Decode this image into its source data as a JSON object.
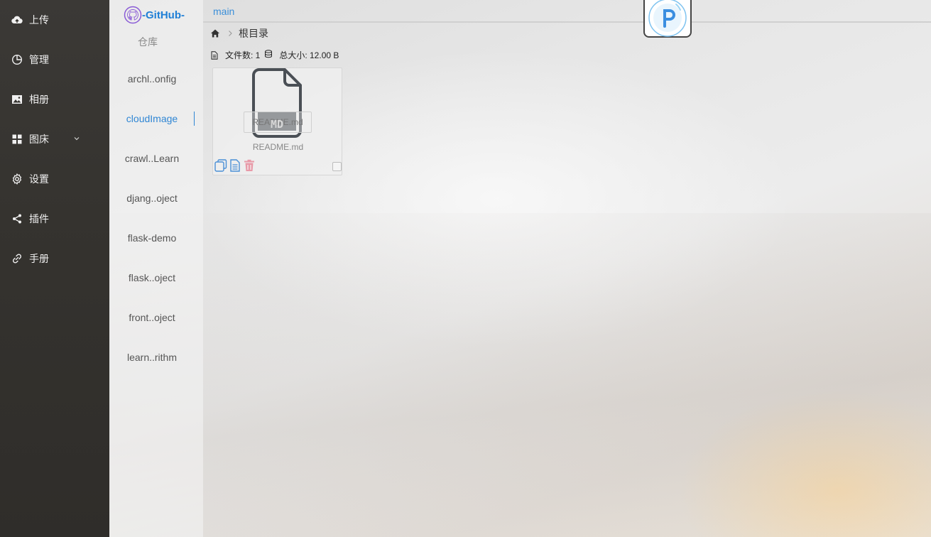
{
  "nav": {
    "items": [
      {
        "label": "上传",
        "icon": "cloud-upload-icon"
      },
      {
        "label": "管理",
        "icon": "pie-chart-icon"
      },
      {
        "label": "相册",
        "icon": "picture-icon"
      },
      {
        "label": "图床",
        "icon": "grid-icon"
      },
      {
        "label": "设置",
        "icon": "gear-icon"
      },
      {
        "label": "插件",
        "icon": "share-icon"
      },
      {
        "label": "手册",
        "icon": "link-icon"
      }
    ]
  },
  "repos": {
    "brand": "-GitHub-",
    "subtitle": "仓库",
    "items": [
      {
        "label": "archl..onfig"
      },
      {
        "label": "cloudImage",
        "active": true
      },
      {
        "label": "crawl..Learn"
      },
      {
        "label": "djang..oject"
      },
      {
        "label": "flask-demo"
      },
      {
        "label": "flask..oject"
      },
      {
        "label": "front..oject"
      },
      {
        "label": "learn..rithm"
      }
    ]
  },
  "main": {
    "branch": "main",
    "breadcrumb": {
      "root": "根目录"
    },
    "stats": {
      "file_count_label": "文件数: 1",
      "total_size_label": "总大小: 12.00 B"
    },
    "files": [
      {
        "name": "README.md",
        "tooltip": "README.md",
        "icon_text": "MD"
      }
    ]
  },
  "colors": {
    "accent": "#2f86d4",
    "nav_bg": "#35332f",
    "delete": "#e89aa8"
  }
}
